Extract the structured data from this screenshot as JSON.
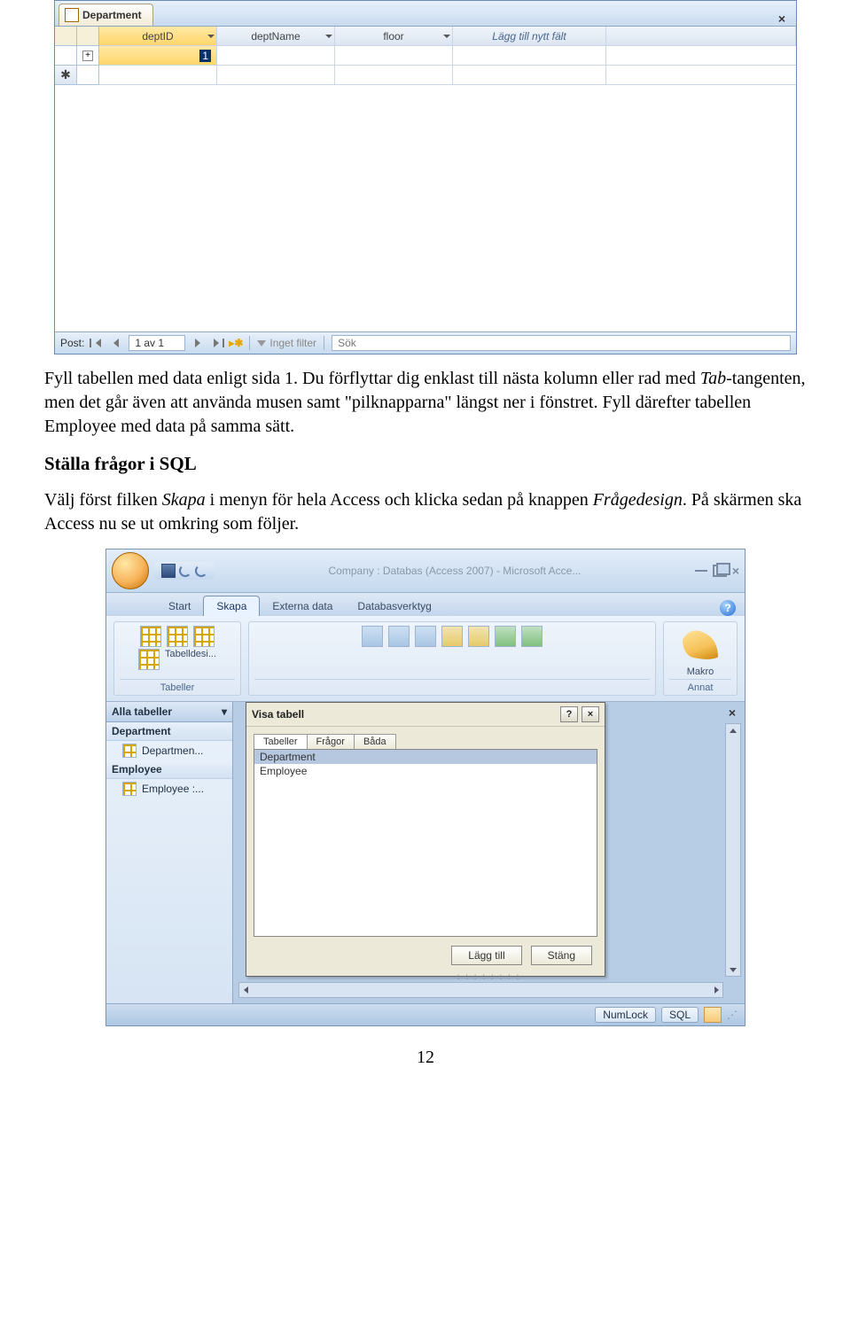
{
  "datasheet": {
    "tab_label": "Department",
    "columns": [
      "deptID",
      "deptName",
      "floor"
    ],
    "add_field_label": "Lägg till nytt fält",
    "row1_value": "1",
    "nav": {
      "label": "Post:",
      "pos": "1 av 1",
      "filter": "Inget filter",
      "search": "Sök"
    }
  },
  "text": {
    "p1a": "Fyll tabellen med data enligt sida 1. Du förflyttar dig enklast till nästa kolumn eller rad med ",
    "p1b": "Tab",
    "p1c": "-tangenten, men det går även att använda musen samt \"pilknapparna\" längst ner i fönstret. Fyll därefter tabellen Employee med data på samma sätt.",
    "h2": "Ställa frågor i SQL",
    "p2a": "Välj först filken ",
    "p2b": "Skapa",
    "p2c": " i menyn för hela Access och klicka sedan på knappen ",
    "p2d": "Frågedesign",
    "p2e": ". På skärmen ska Access nu se ut omkring som följer."
  },
  "access": {
    "title": "Company : Databas (Access 2007) - Microsoft Acce...",
    "tabs": [
      "Start",
      "Skapa",
      "Externa data",
      "Databasverktyg"
    ],
    "ribbon": {
      "g1": "Tabeller",
      "tbl_design": "Tabelldesi...",
      "g_right": "Annat",
      "macro": "Makro"
    },
    "nav": {
      "hdr": "Alla tabeller",
      "g1": "Department",
      "i1": "Departmen...",
      "g2": "Employee",
      "i2": "Employee :..."
    },
    "dialog": {
      "title": "Visa tabell",
      "tabs": [
        "Tabeller",
        "Frågor",
        "Båda"
      ],
      "items": [
        "Department",
        "Employee"
      ],
      "add": "Lägg till",
      "close": "Stäng"
    },
    "status": {
      "numlock": "NumLock",
      "sql": "SQL"
    }
  },
  "pagenum": "12"
}
